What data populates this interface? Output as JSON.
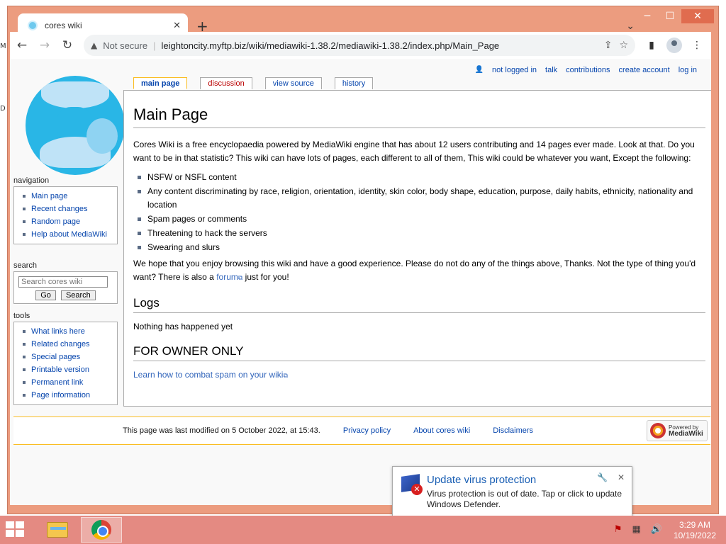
{
  "browser": {
    "tab_title": "cores wiki",
    "new_tab": "+",
    "not_secure": "Not secure",
    "url": "leightoncity.myftp.biz/wiki/mediawiki-1.38.2/mediawiki-1.38.2/index.php/Main_Page",
    "window_controls": {
      "minimize": "─",
      "maximize": "☐",
      "close": "✕"
    }
  },
  "personal_tools": {
    "not_logged_in": "not logged in",
    "talk": "talk",
    "contributions": "contributions",
    "create_account": "create account",
    "log_in": "log in"
  },
  "page_tabs": {
    "main_page": "main page",
    "discussion": "discussion",
    "view_source": "view source",
    "history": "history"
  },
  "article": {
    "title": "Main Page",
    "intro": "Cores Wiki is a free encyclopaedia powered by MediaWiki engine that has about 12 users contributing and 14 pages ever made. Look at that. Do you want to be in that statistic? This wiki can have lots of pages, each different to all of them, This wiki could be whatever you want, Except the following:",
    "rules": [
      "NSFW or NSFL content",
      "Any content discriminating by race, religion, orientation, identity, skin color, body shape, education, purpose, daily habits, ethnicity, nationality and location",
      "Spam pages or comments",
      "Threatening to hack the servers",
      "Swearing and slurs"
    ],
    "closing_pre": "We hope that you enjoy browsing this wiki and have a good experience. Please do not do any of the things above, Thanks. Not the type of thing you'd want? There is also a ",
    "closing_link": "forum",
    "closing_post": " just for you!",
    "logs_heading": "Logs",
    "logs_text": "Nothing has happened yet",
    "owner_heading": "FOR OWNER ONLY",
    "owner_link": "Learn how to combat spam on your wiki"
  },
  "sidebar": {
    "navigation_label": "navigation",
    "navigation": [
      "Main page",
      "Recent changes",
      "Random page",
      "Help about MediaWiki"
    ],
    "search_label": "search",
    "search_placeholder": "Search cores wiki",
    "go_button": "Go",
    "search_button": "Search",
    "tools_label": "tools",
    "tools": [
      "What links here",
      "Related changes",
      "Special pages",
      "Printable version",
      "Permanent link",
      "Page information"
    ]
  },
  "footer": {
    "last_modified": "This page was last modified on 5 October 2022, at 15:43.",
    "privacy": "Privacy policy",
    "about": "About cores wiki",
    "disclaimers": "Disclaimers",
    "powered_by": "Powered by",
    "mediawiki": "MediaWiki"
  },
  "notification": {
    "title": "Update virus protection",
    "body": "Virus protection is out of date. Tap or click to update Windows Defender."
  },
  "taskbar": {
    "time": "3:29 AM",
    "date": "10/19/2022"
  },
  "colors": {
    "accent_window": "#ec9c7f",
    "taskbar": "#e48a82",
    "link": "#0645ad",
    "tab_border": "#fabd23"
  }
}
